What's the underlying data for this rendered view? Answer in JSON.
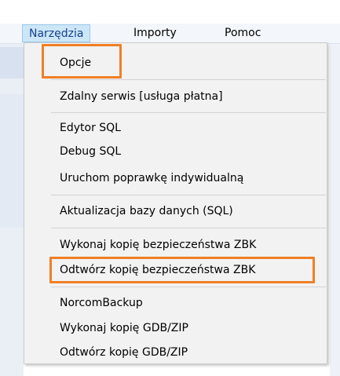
{
  "menubar": {
    "items": [
      {
        "label": "Narzędzia"
      },
      {
        "label": "Importy"
      },
      {
        "label": "Pomoc"
      }
    ]
  },
  "dropdown": {
    "items": [
      {
        "label": "Opcje"
      },
      {
        "label": "Zdalny serwis [usługa płatna]"
      },
      {
        "label": "Edytor SQL"
      },
      {
        "label": "Debug SQL"
      },
      {
        "label": "Uruchom poprawkę indywidualną"
      },
      {
        "label": "Aktualizacja bazy danych (SQL)"
      },
      {
        "label": "Wykonaj kopię bezpieczeństwa ZBK"
      },
      {
        "label": "Odtwórz kopię bezpieczeństwa ZBK"
      },
      {
        "label": "NorcomBackup"
      },
      {
        "label": "Wykonaj kopię GDB/ZIP"
      },
      {
        "label": "Odtwórz kopię GDB/ZIP"
      }
    ]
  },
  "colors": {
    "highlight": "#f07f25",
    "active_menu_bg": "#cde6f7",
    "menu_bg": "#f2f2f2"
  }
}
